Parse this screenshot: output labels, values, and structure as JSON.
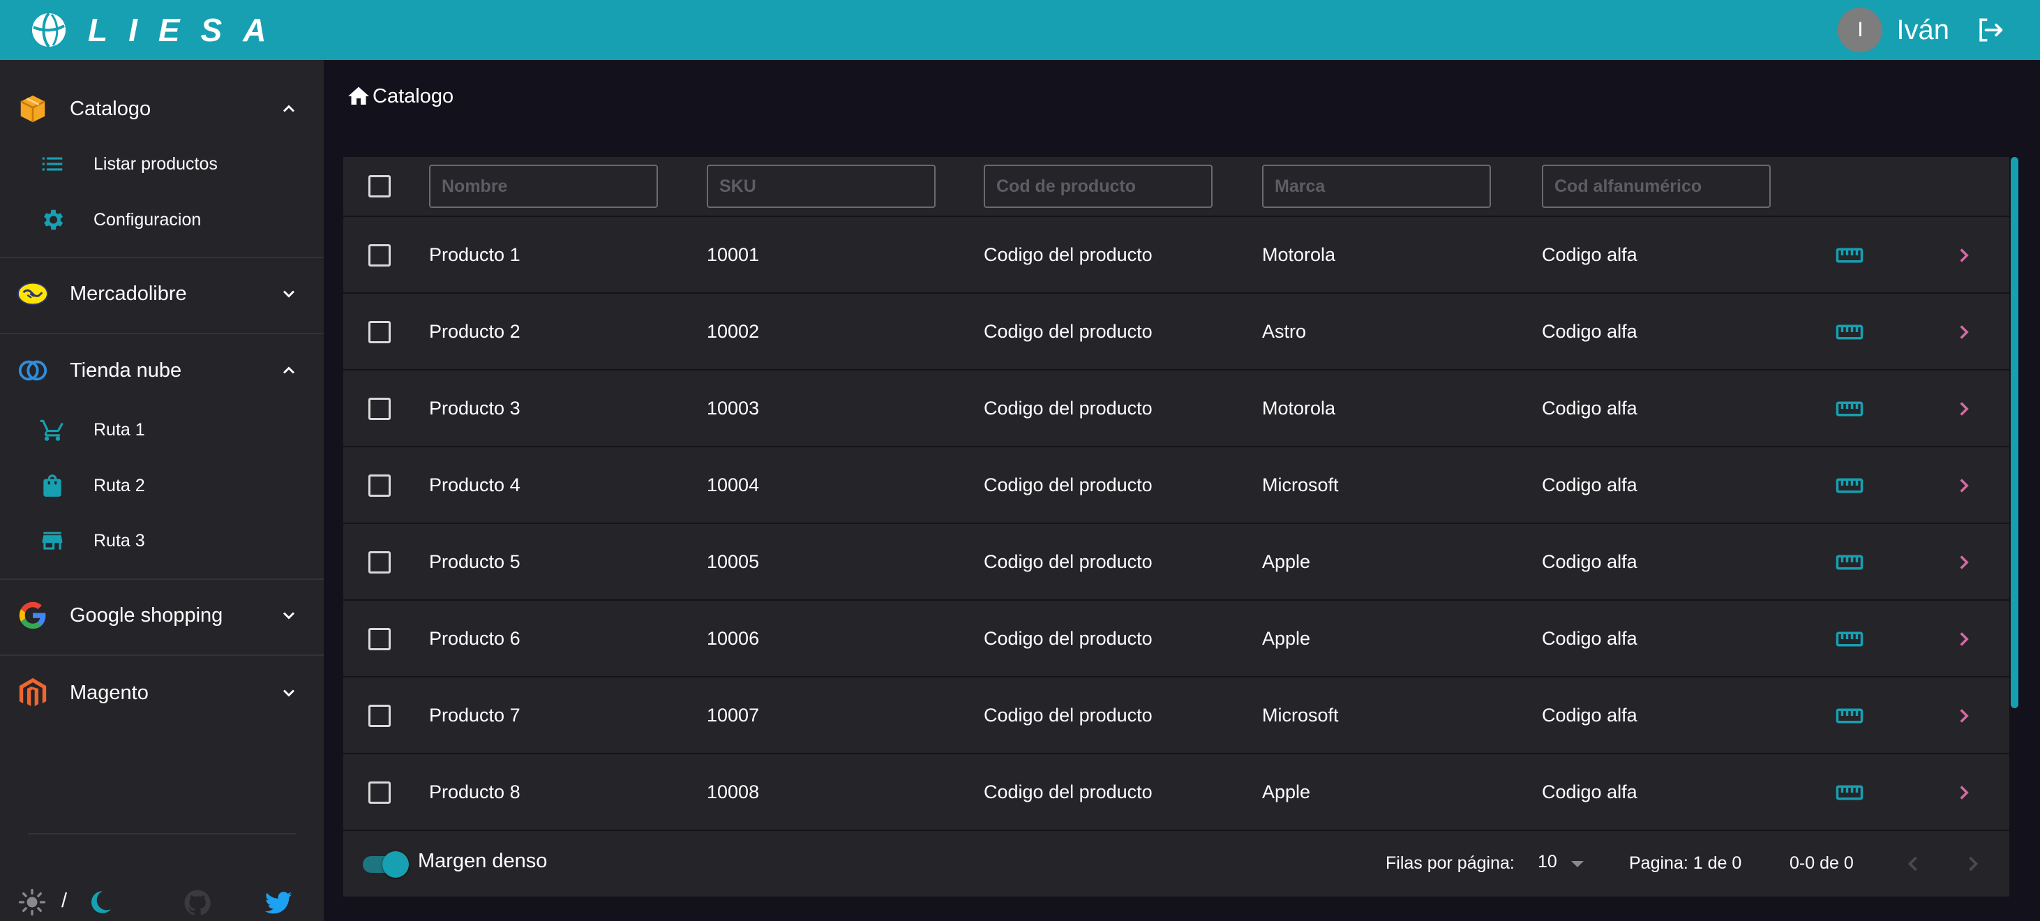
{
  "header": {
    "brand": "LIESA",
    "user_initial": "I",
    "user_name": "Iván"
  },
  "sidebar": {
    "groups": [
      {
        "label": "Catalogo",
        "icon": "box-icon",
        "expanded": true,
        "items": [
          {
            "label": "Listar productos",
            "icon": "list-icon"
          },
          {
            "label": "Configuracion",
            "icon": "gear-icon"
          }
        ]
      },
      {
        "label": "Mercadolibre",
        "icon": "handshake-icon",
        "expanded": false,
        "items": []
      },
      {
        "label": "Tienda nube",
        "icon": "cloud-icon",
        "expanded": true,
        "items": [
          {
            "label": "Ruta 1",
            "icon": "cart-icon"
          },
          {
            "label": "Ruta 2",
            "icon": "shopping-bag-icon"
          },
          {
            "label": "Ruta 3",
            "icon": "store-icon"
          }
        ]
      },
      {
        "label": "Google shopping",
        "icon": "google-icon",
        "expanded": false,
        "items": []
      },
      {
        "label": "Magento",
        "icon": "magento-icon",
        "expanded": false,
        "items": []
      }
    ],
    "footer": {
      "theme_separator": "/"
    }
  },
  "breadcrumb": {
    "label": "Catalogo"
  },
  "table": {
    "filters": {
      "nombre": "Nombre",
      "sku": "SKU",
      "cod_producto": "Cod de producto",
      "marca": "Marca",
      "cod_alfa": "Cod alfanumérico"
    },
    "rows": [
      {
        "nombre": "Producto 1",
        "sku": "10001",
        "cod": "Codigo del producto",
        "marca": "Motorola",
        "alfa": "Codigo alfa"
      },
      {
        "nombre": "Producto 2",
        "sku": "10002",
        "cod": "Codigo del producto",
        "marca": "Astro",
        "alfa": "Codigo alfa"
      },
      {
        "nombre": "Producto 3",
        "sku": "10003",
        "cod": "Codigo del producto",
        "marca": "Motorola",
        "alfa": "Codigo alfa"
      },
      {
        "nombre": "Producto 4",
        "sku": "10004",
        "cod": "Codigo del producto",
        "marca": "Microsoft",
        "alfa": "Codigo alfa"
      },
      {
        "nombre": "Producto 5",
        "sku": "10005",
        "cod": "Codigo del producto",
        "marca": "Apple",
        "alfa": "Codigo alfa"
      },
      {
        "nombre": "Producto 6",
        "sku": "10006",
        "cod": "Codigo del producto",
        "marca": "Apple",
        "alfa": "Codigo alfa"
      },
      {
        "nombre": "Producto 7",
        "sku": "10007",
        "cod": "Codigo del producto",
        "marca": "Microsoft",
        "alfa": "Codigo alfa"
      },
      {
        "nombre": "Producto 8",
        "sku": "10008",
        "cod": "Codigo del producto",
        "marca": "Apple",
        "alfa": "Codigo alfa"
      }
    ],
    "footer": {
      "dense_label": "Margen denso",
      "dense_on": true,
      "rows_per_page_label": "Filas por página:",
      "rows_per_page_value": "10",
      "page_label": "Pagina: 1 de 0",
      "range_label": "0-0 de 0"
    }
  },
  "colors": {
    "accent": "#16a0b1",
    "row_action": "#d36ba2",
    "sidebar_bg": "#252428",
    "page_bg": "#13111c"
  }
}
